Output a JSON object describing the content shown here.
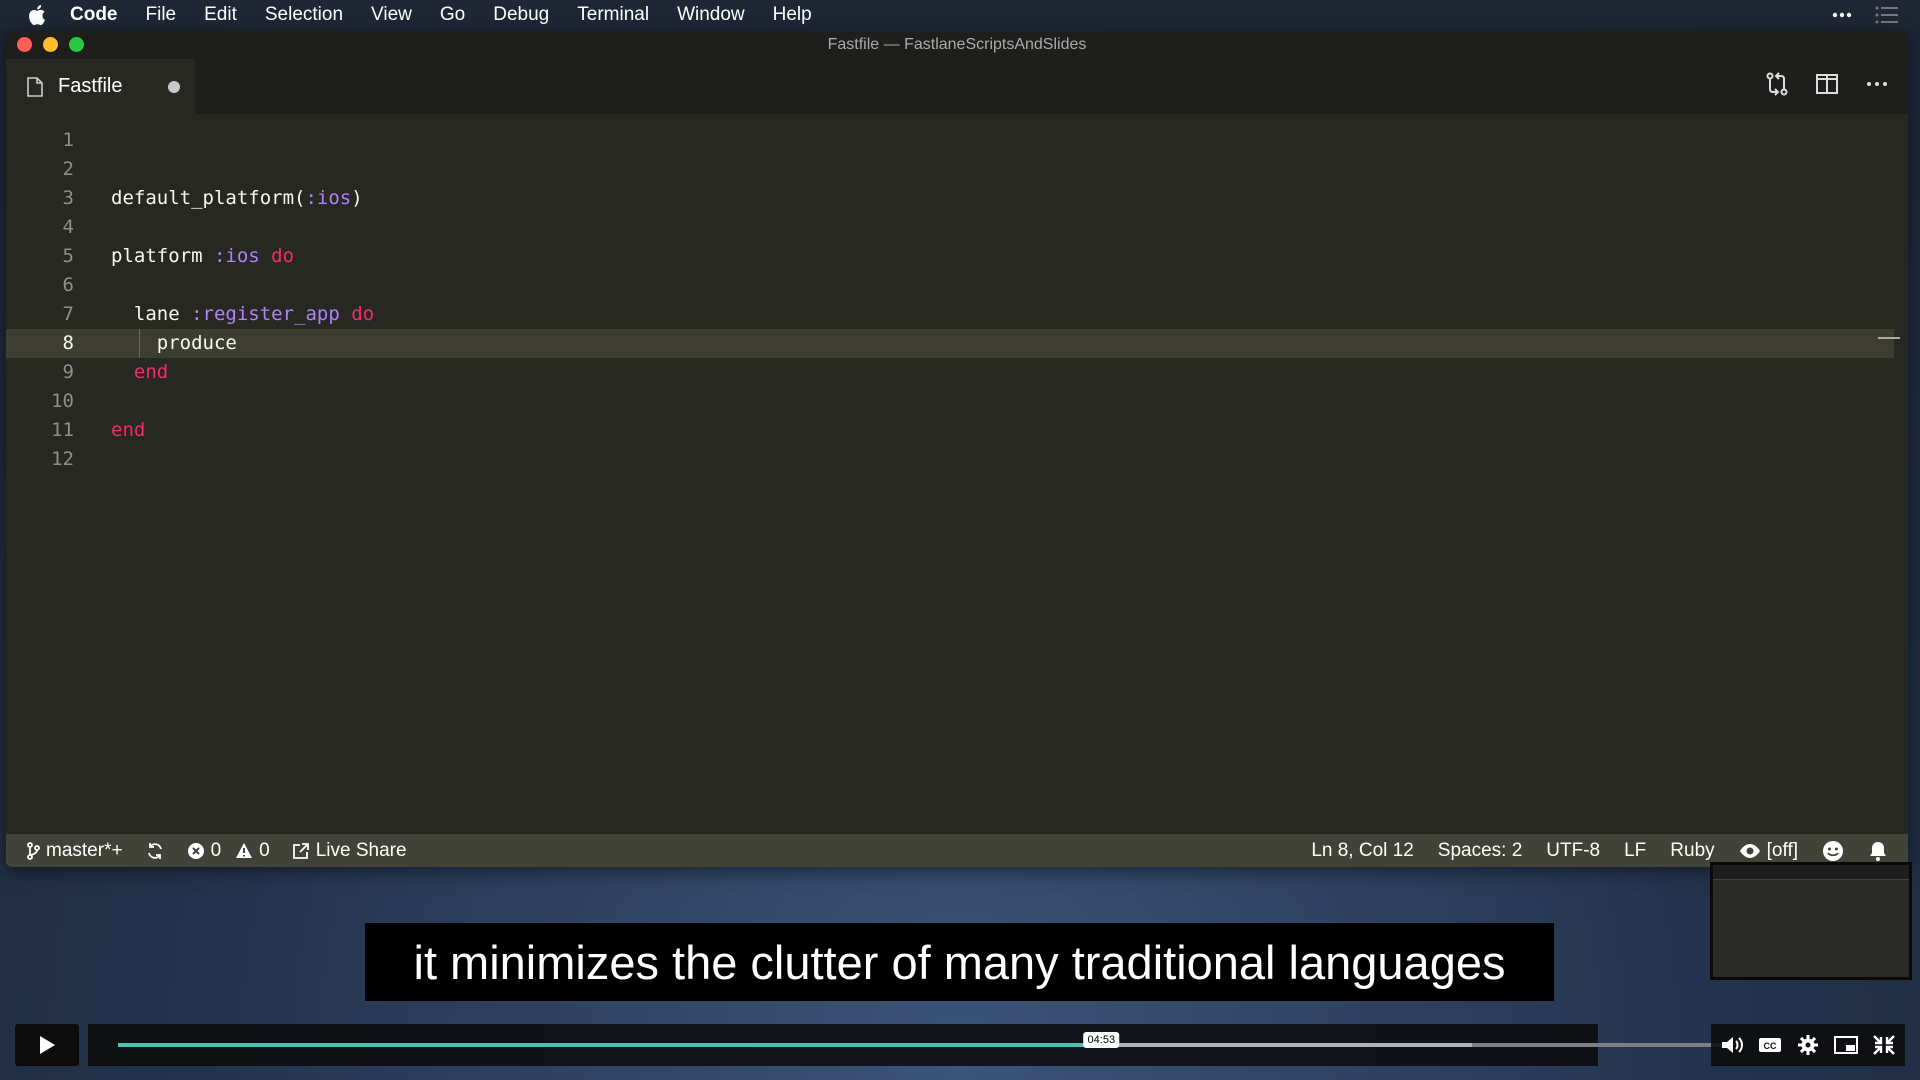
{
  "menubar": {
    "items": [
      "Code",
      "File",
      "Edit",
      "Selection",
      "View",
      "Go",
      "Debug",
      "Terminal",
      "Window",
      "Help"
    ]
  },
  "window": {
    "title": "Fastfile — FastlaneScriptsAndSlides"
  },
  "tab": {
    "label": "Fastfile"
  },
  "editor": {
    "current_line": 8,
    "lines": [
      {
        "num": "1",
        "code": ""
      },
      {
        "num": "2",
        "code": ""
      },
      {
        "num": "3",
        "code": "default_platform(:ios)"
      },
      {
        "num": "4",
        "code": ""
      },
      {
        "num": "5",
        "code": "platform :ios do"
      },
      {
        "num": "6",
        "code": ""
      },
      {
        "num": "7",
        "code": "  lane :register_app do"
      },
      {
        "num": "8",
        "code": "    produce"
      },
      {
        "num": "9",
        "code": "  end"
      },
      {
        "num": "10",
        "code": ""
      },
      {
        "num": "11",
        "code": "end"
      },
      {
        "num": "12",
        "code": ""
      }
    ]
  },
  "statusbar": {
    "branch": "master*+",
    "errors": "0",
    "warnings": "0",
    "live_share": "Live Share",
    "position": "Ln 8, Col 12",
    "spaces": "Spaces: 2",
    "encoding": "UTF-8",
    "eol": "LF",
    "language": "Ruby",
    "watch": "[off]"
  },
  "video": {
    "caption": "it minimizes the clutter of many traditional languages",
    "time": "04:53",
    "progress": 0.61,
    "buffered": 0.84
  }
}
